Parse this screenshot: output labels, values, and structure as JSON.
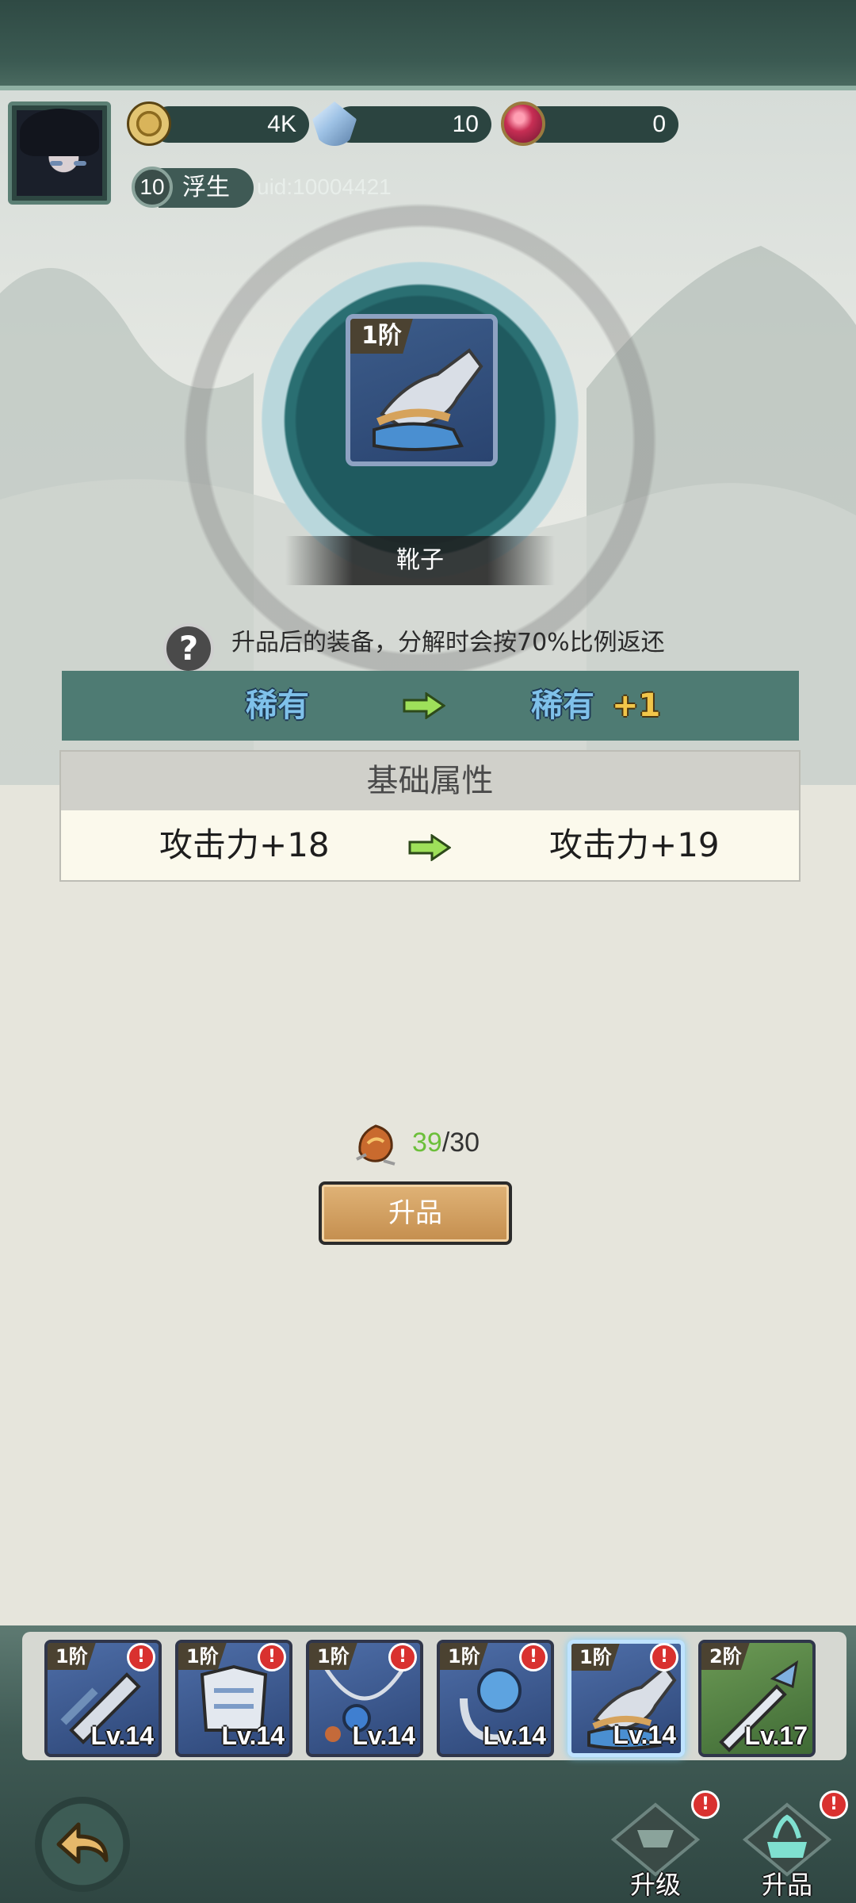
{
  "header": {
    "resources": [
      {
        "icon": "coin-icon",
        "value": "4K"
      },
      {
        "icon": "crystal-icon",
        "value": "10"
      },
      {
        "icon": "orb-icon",
        "value": "0"
      }
    ],
    "player": {
      "level": "10",
      "name": "浮生",
      "uid": "uid:10004421"
    }
  },
  "equipment": {
    "tier": "1阶",
    "name": "靴子",
    "note": "升品后的装备，分解时会按70%比例返还"
  },
  "rarity": {
    "from": "稀有",
    "to": "稀有",
    "to_plus": "+1"
  },
  "attributes": {
    "header": "基础属性",
    "rows": [
      {
        "before": "攻击力+18",
        "after": "攻击力+19"
      }
    ]
  },
  "material": {
    "have": "39",
    "need": "/30"
  },
  "actions": {
    "upgrade_label": "升品"
  },
  "slots": [
    {
      "tier": "1阶",
      "level": "Lv.14",
      "rarity": "blue",
      "alert": "!"
    },
    {
      "tier": "1阶",
      "level": "Lv.14",
      "rarity": "blue",
      "alert": "!"
    },
    {
      "tier": "1阶",
      "level": "Lv.14",
      "rarity": "blue",
      "alert": "!"
    },
    {
      "tier": "1阶",
      "level": "Lv.14",
      "rarity": "blue",
      "alert": "!"
    },
    {
      "tier": "1阶",
      "level": "Lv.14",
      "rarity": "blue",
      "alert": "!",
      "selected": true
    },
    {
      "tier": "2阶",
      "level": "Lv.17",
      "rarity": "green"
    }
  ],
  "tabs": [
    {
      "label": "升级",
      "alert": "!"
    },
    {
      "label": "升品",
      "alert": "!"
    }
  ],
  "colors": {
    "accent": "#4e7b73",
    "rarity_text": "#7fc1ea",
    "plus_text": "#f2c64a",
    "have_count": "#6cbf3a"
  }
}
